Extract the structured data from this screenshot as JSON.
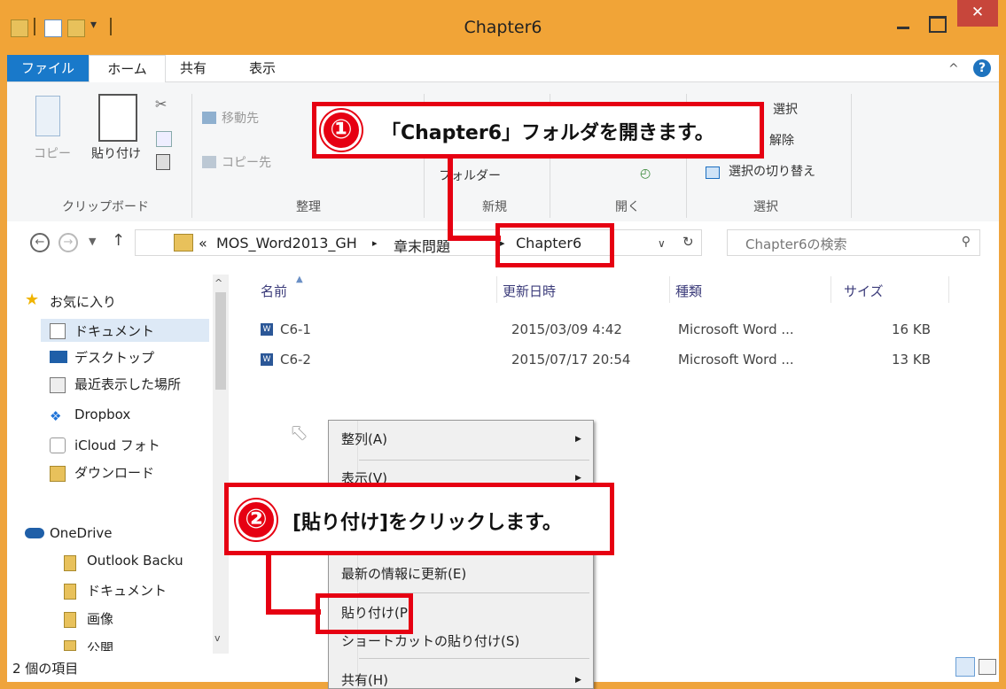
{
  "window": {
    "title": "Chapter6"
  },
  "ribbon": {
    "tabs": [
      "ファイル",
      "ホーム",
      "共有",
      "表示"
    ],
    "clipboard": {
      "copy": "コピー",
      "paste": "貼り付け",
      "group": "クリップボード"
    },
    "organize": {
      "move_to": "移動先",
      "copy_to": "コピー先",
      "group": "整理"
    },
    "new": {
      "new_folder": "フォルダー",
      "group": "新規"
    },
    "open": {
      "group": "開く"
    },
    "select": {
      "select_all": "選択",
      "select_none": "解除",
      "invert": "選択の切り替え",
      "group": "選択"
    }
  },
  "address": {
    "crumbs": [
      "«",
      "MOS_Word2013_GH",
      "▸",
      "章末問題",
      "▸",
      "Chapter6"
    ],
    "search_placeholder": "Chapter6の検索"
  },
  "navpane": {
    "items": [
      "お気に入り",
      "ドキュメント",
      "デスクトップ",
      "最近表示した場所",
      "Dropbox",
      "iCloud フォト",
      "ダウンロード",
      "OneDrive",
      "Outlook Backu",
      "ドキュメント",
      "画像",
      "公開"
    ]
  },
  "files": {
    "columns": [
      "名前",
      "更新日時",
      "種類",
      "サイズ"
    ],
    "rows": [
      {
        "name": "C6-1",
        "date": "2015/03/09 4:42",
        "type": "Microsoft Word ...",
        "size": "16 KB"
      },
      {
        "name": "C6-2",
        "date": "2015/07/17 20:54",
        "type": "Microsoft Word ...",
        "size": "13 KB"
      }
    ]
  },
  "context_menu": {
    "items": [
      "整列(A)",
      "表示(V)",
      "最新の情報に更新(E)",
      "貼り付け(P)",
      "ショートカットの貼り付け(S)",
      "共有(H)"
    ]
  },
  "status": {
    "text": "2 個の項目"
  },
  "annotations": {
    "step1": {
      "num": "①",
      "text": "「Chapter6」フォルダを開きます。"
    },
    "step2": {
      "num": "②",
      "text": "[貼り付け]をクリックします。"
    }
  },
  "colors": {
    "title_bar": "#f1a437",
    "accent_red": "#e60012",
    "file_tab": "#1979ca",
    "close_button": "#c7463b"
  }
}
